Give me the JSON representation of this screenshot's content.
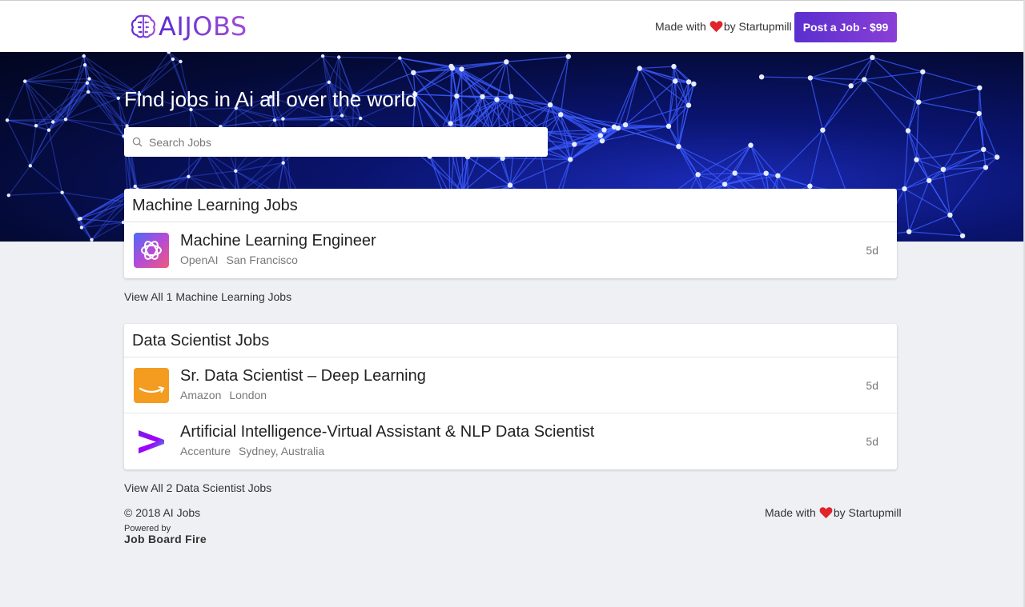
{
  "header": {
    "logo_text": "AIJOBS",
    "made_with_prefix": "Made with",
    "made_with_suffix": "by Startupmill",
    "post_button": "Post a Job - $99"
  },
  "hero": {
    "title": "Find jobs in Ai all over the world",
    "search_placeholder": "Search Jobs"
  },
  "sections": [
    {
      "title": "Machine Learning Jobs",
      "view_all": "View All 1 Machine Learning Jobs",
      "jobs": [
        {
          "title": "Machine Learning Engineer",
          "company": "OpenAI",
          "location": "San Francisco",
          "age": "5d",
          "logo": "openai-logo-icon"
        }
      ]
    },
    {
      "title": "Data Scientist Jobs",
      "view_all": "View All 2 Data Scientist Jobs",
      "jobs": [
        {
          "title": "Sr. Data Scientist – Deep Learning",
          "company": "Amazon",
          "location": "London",
          "age": "5d",
          "logo": "amazon-logo-icon"
        },
        {
          "title": "Artificial Intelligence-Virtual Assistant & NLP Data Scientist",
          "company": "Accenture",
          "location": "Sydney, Australia",
          "age": "5d",
          "logo": "accenture-logo-icon"
        }
      ]
    }
  ],
  "footer": {
    "copyright": "© 2018 AI Jobs",
    "powered_by": "Powered by",
    "powered_by_name": "Job Board Fire",
    "made_with_prefix": "Made with",
    "made_with_suffix": "by Startupmill"
  },
  "colors": {
    "accent": "#6a35d3",
    "heart": "#e0242c"
  }
}
